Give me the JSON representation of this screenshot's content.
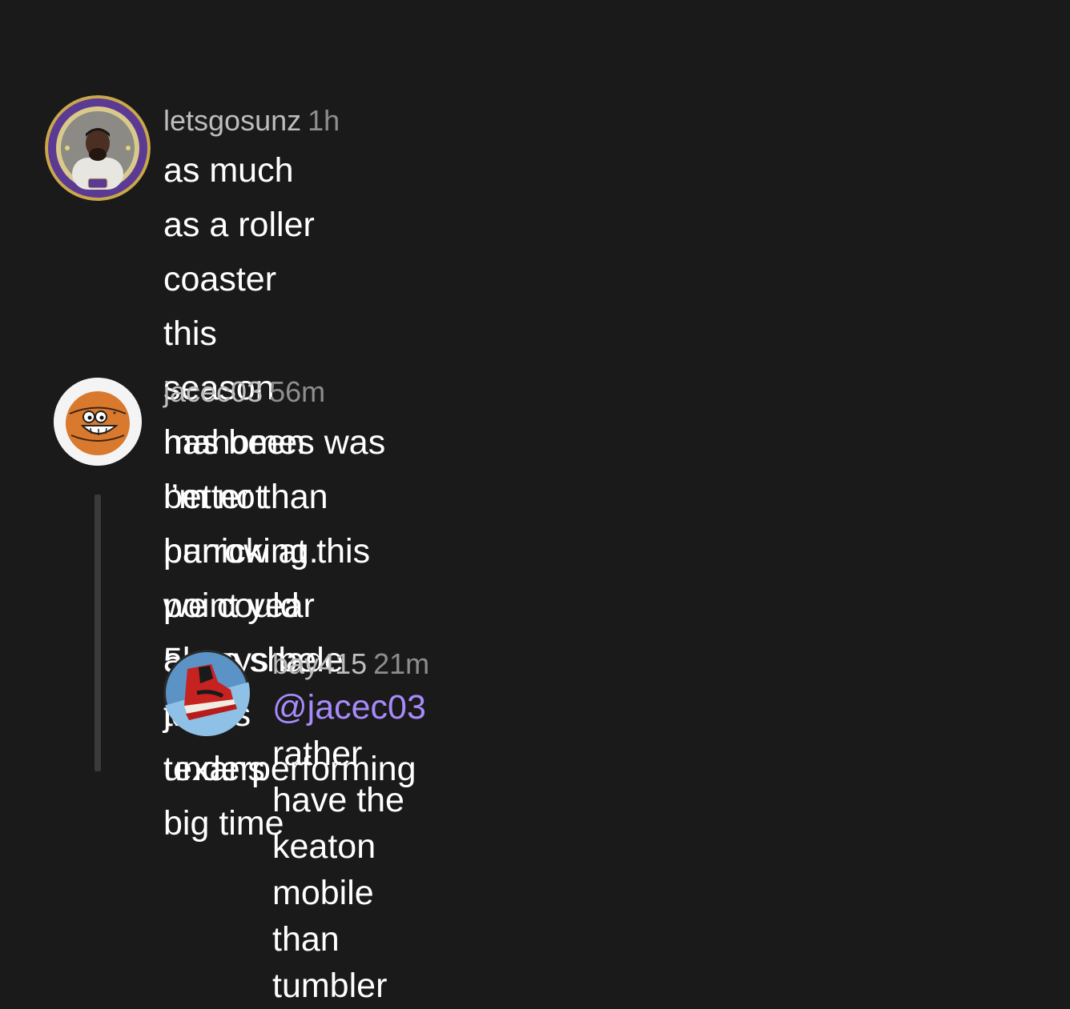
{
  "comments": [
    {
      "username": "letsgosunz",
      "time": "1h",
      "text_lines": [
        "as much as a roller coaster this season has been",
        "i’m not panicking. we could always be the texans"
      ],
      "avatar_badge": "B·R"
    },
    {
      "username": "jacec03",
      "time": "56m",
      "text_lines": [
        "mahomes was better than burrow at this point year",
        "5. no shade joey’s underperforming big time"
      ]
    },
    {
      "username": "bay415",
      "time": "21m",
      "mention": "@jacec03",
      "text_line1_rest": " rather have the keaton mobile",
      "text_line2": "than tumbler"
    }
  ],
  "icons": {
    "comment1_avatar": "person-avatar-icon",
    "comment2_avatar": "smiling-basketball-avatar-icon",
    "comment3_avatar": "red-sneaker-avatar-icon"
  },
  "colors": {
    "background": "#1a1a1a",
    "mention": "#a78bfa",
    "username": "#bdbdbd",
    "time": "#8e8e8e",
    "avatar_ring": "#6b3fa0"
  }
}
